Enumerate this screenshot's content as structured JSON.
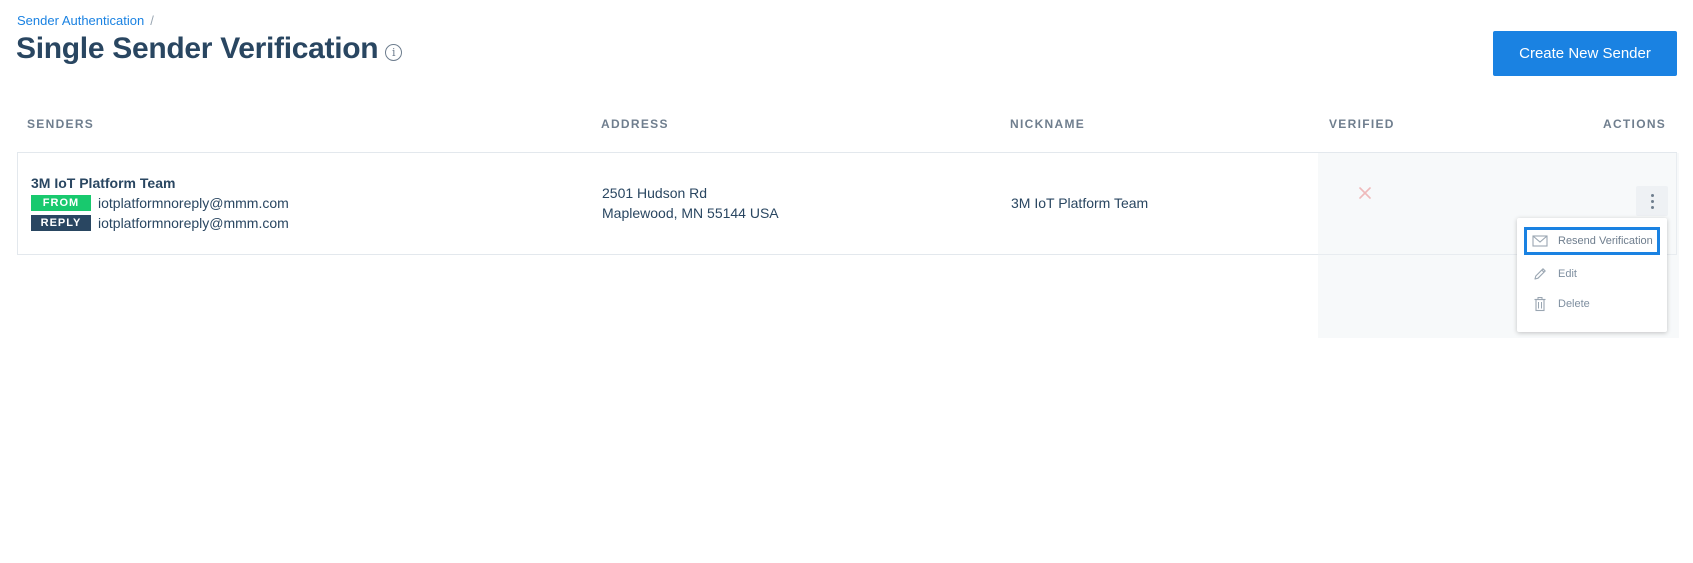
{
  "breadcrumb": {
    "parent": "Sender Authentication",
    "separator": "/"
  },
  "page": {
    "title": "Single Sender Verification"
  },
  "header": {
    "create_button": "Create New Sender"
  },
  "table": {
    "columns": {
      "senders": "SENDERS",
      "address": "ADDRESS",
      "nickname": "NICKNAME",
      "verified": "VERIFIED",
      "actions": "ACTIONS"
    },
    "rows": [
      {
        "sender_name": "3M IoT Platform Team",
        "from_badge": "FROM",
        "from_email": "iotplatformnoreply@mmm.com",
        "reply_badge": "REPLY",
        "reply_email": "iotplatformnoreply@mmm.com",
        "address_line1": "2501 Hudson Rd",
        "address_line2": "Maplewood, MN 55144 USA",
        "nickname": "3M IoT Platform Team",
        "verified_icon": "x-icon"
      }
    ]
  },
  "actions_menu": {
    "items": [
      {
        "label": "Resend Verification",
        "icon": "envelope-icon"
      },
      {
        "label": "Edit",
        "icon": "pencil-icon"
      },
      {
        "label": "Delete",
        "icon": "trash-icon"
      }
    ]
  },
  "colors": {
    "accent": "#1a82e2",
    "text": "#294661",
    "from_badge": "#18c96e",
    "reply_badge": "#294661",
    "unverified_x": "#f08a8a"
  }
}
